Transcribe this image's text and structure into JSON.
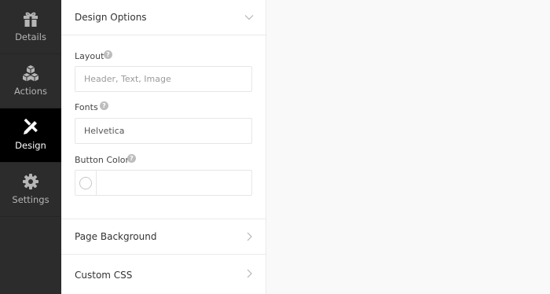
{
  "nav": {
    "items": [
      {
        "label": "Details",
        "icon": "gift-icon",
        "active": false
      },
      {
        "label": "Actions",
        "icon": "boxes-icon",
        "active": false
      },
      {
        "label": "Design",
        "icon": "pencil-ruler-icon",
        "active": true
      },
      {
        "label": "Settings",
        "icon": "gear-icon",
        "active": false
      }
    ]
  },
  "panel": {
    "design_options": {
      "title": "Design Options",
      "layout": {
        "label": "Layout",
        "placeholder": "Header, Text, Image"
      },
      "fonts": {
        "label": "Fonts",
        "value": "Helvetica"
      },
      "button_color": {
        "label": "Button Color",
        "value": ""
      }
    },
    "page_background": {
      "title": "Page Background"
    },
    "custom_css": {
      "title": "Custom CSS"
    }
  },
  "colors": {
    "nav_bg": "#2c2c2c",
    "nav_active_bg": "#000000",
    "panel_bg": "#ffffff",
    "page_bg": "#f9f9f9"
  }
}
